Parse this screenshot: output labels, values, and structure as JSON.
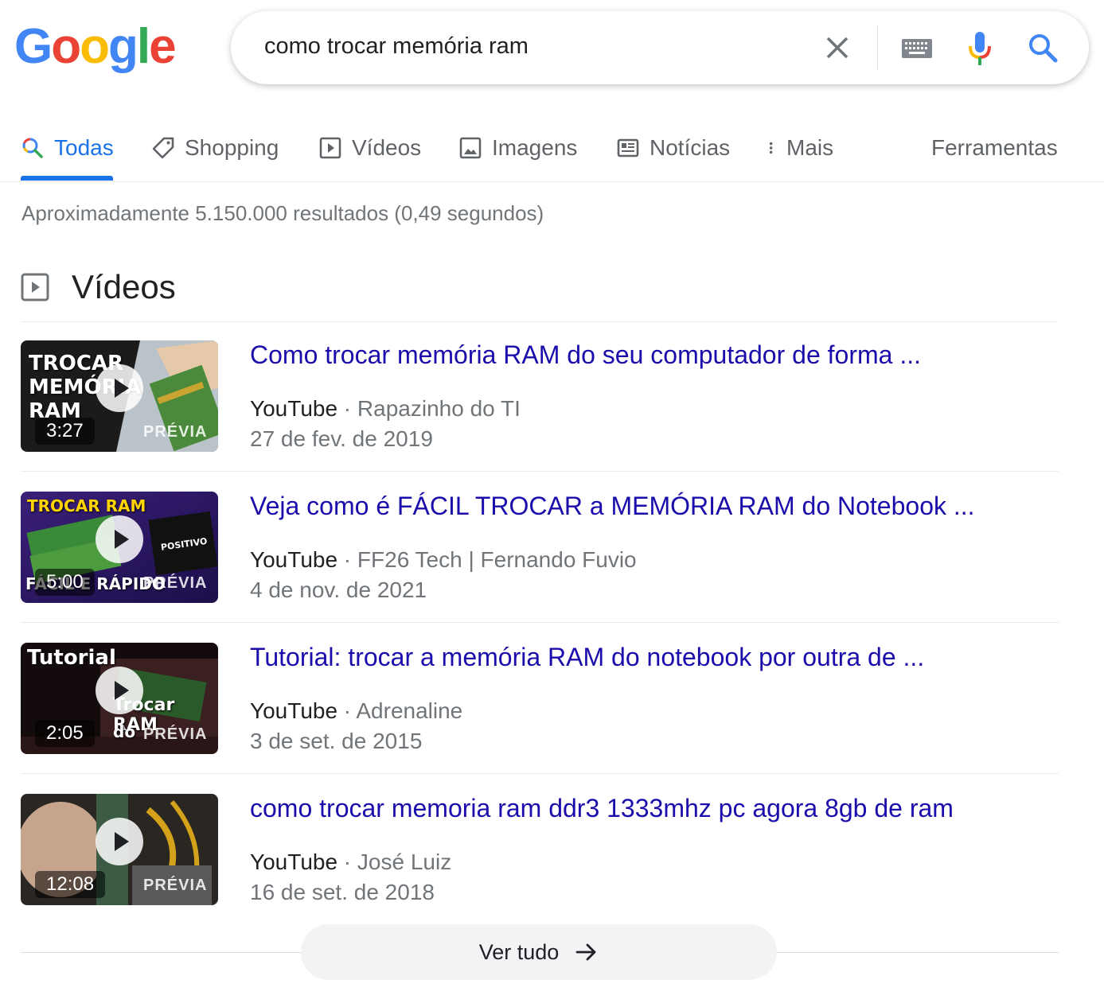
{
  "logo": {
    "letters": [
      "G",
      "o",
      "o",
      "g",
      "l",
      "e"
    ],
    "colors": [
      "#4285F4",
      "#EA4335",
      "#FBBC05",
      "#4285F4",
      "#34A853",
      "#EA4335"
    ]
  },
  "search": {
    "query": "como trocar memória ram"
  },
  "tabs": [
    {
      "label": "Todas",
      "icon": "search-icon",
      "active": true
    },
    {
      "label": "Shopping",
      "icon": "tag-icon"
    },
    {
      "label": "Vídeos",
      "icon": "video-icon"
    },
    {
      "label": "Imagens",
      "icon": "image-icon"
    },
    {
      "label": "Notícias",
      "icon": "newspaper-icon"
    },
    {
      "label": "Mais",
      "icon": "more-vert-icon"
    }
  ],
  "tools_label": "Ferramentas",
  "stats": "Aproximadamente 5.150.000 resultados (0,49 segundos)",
  "videos_section": {
    "title": "Vídeos",
    "items": [
      {
        "title": "Como trocar memória RAM do seu computador de forma ...",
        "source": "YouTube",
        "channel": "Rapazinho do TI",
        "date": "27 de fev. de 2019",
        "duration": "3:27",
        "preview": "PRÉVIA",
        "thumb_text": [
          "TROCAR",
          "MEMÓRIA",
          "RAM"
        ]
      },
      {
        "title": "Veja como é FÁCIL TROCAR a MEMÓRIA RAM do Notebook ...",
        "source": "YouTube",
        "channel": "FF26 Tech | Fernando Fuvio",
        "date": "4 de nov. de 2021",
        "duration": "5:00",
        "preview": "PRÉVIA",
        "thumb_text": [
          "TROCAR RAM",
          "FÁCIL E RÁPIDO"
        ]
      },
      {
        "title": "Tutorial: trocar a memória RAM do notebook por outra de ...",
        "source": "YouTube",
        "channel": "Adrenaline",
        "date": "3 de set. de 2015",
        "duration": "2:05",
        "preview": "PRÉVIA",
        "thumb_text": [
          "Tutorial",
          "Trocar RAM",
          "do"
        ]
      },
      {
        "title": "como trocar memoria ram ddr3 1333mhz pc agora 8gb de ram",
        "source": "YouTube",
        "channel": "José Luiz",
        "date": "16 de set. de 2018",
        "duration": "12:08",
        "preview": "PRÉVIA",
        "thumb_text": []
      }
    ],
    "more_label": "Ver tudo"
  }
}
